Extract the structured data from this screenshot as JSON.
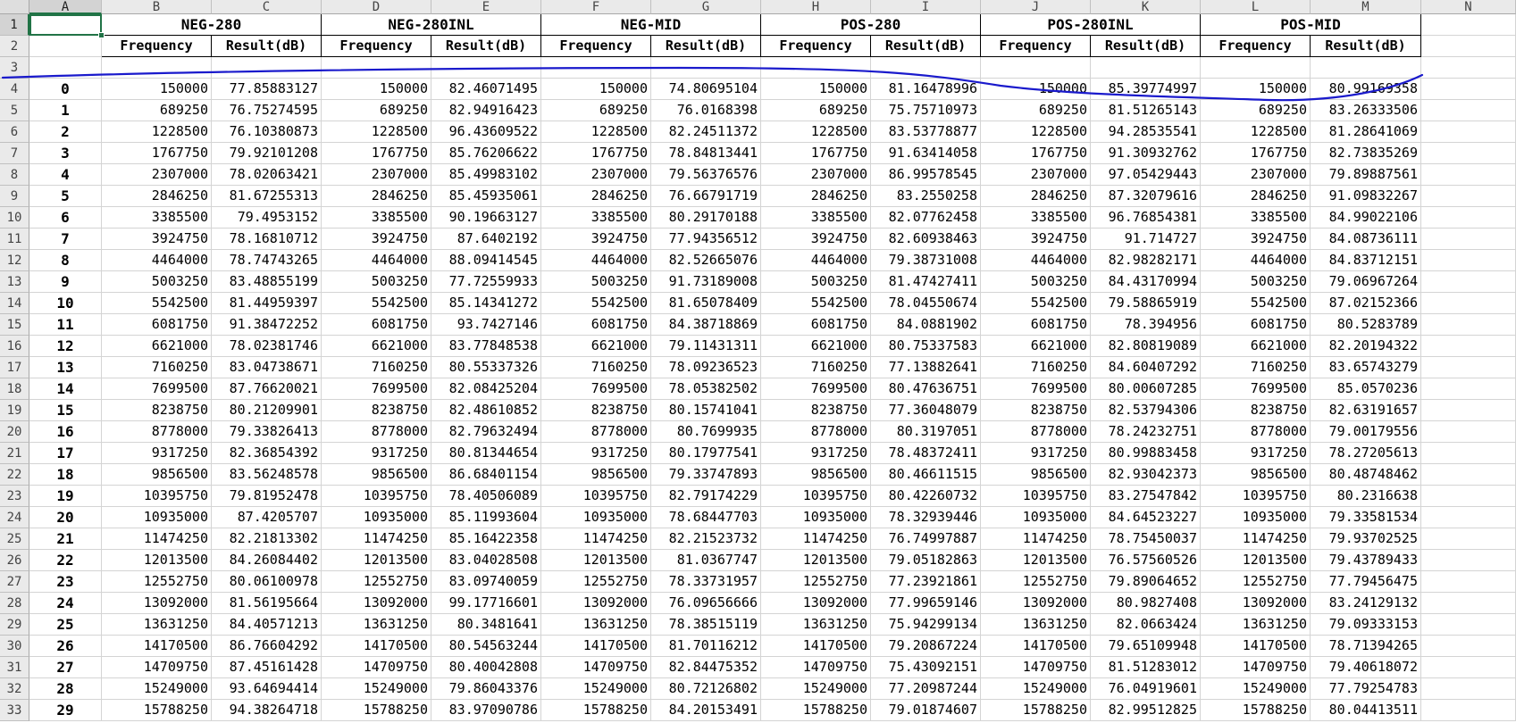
{
  "columns": [
    "A",
    "B",
    "C",
    "D",
    "E",
    "F",
    "G",
    "H",
    "I",
    "J",
    "K",
    "L",
    "M",
    "N"
  ],
  "groups": [
    "NEG-280",
    "NEG-280INL",
    "NEG-MID",
    "POS-280",
    "POS-280INL",
    "POS-MID"
  ],
  "sub_headers": [
    "Frequency",
    "Result(dB)"
  ],
  "row_numbers": [
    1,
    2,
    3,
    4,
    5,
    6,
    7,
    8,
    9,
    10,
    11,
    12,
    13,
    14,
    15,
    16,
    17,
    18,
    19,
    20,
    21,
    22,
    23,
    24,
    25,
    26,
    27,
    28,
    29,
    30,
    31,
    32,
    33
  ],
  "rows": [
    {
      "index": "0",
      "values": [
        "150000",
        "77.85883127",
        "150000",
        "82.46071495",
        "150000",
        "74.80695104",
        "150000",
        "81.16478996",
        "150000",
        "85.39774997",
        "150000",
        "80.99169358"
      ]
    },
    {
      "index": "1",
      "values": [
        "689250",
        "76.75274595",
        "689250",
        "82.94916423",
        "689250",
        "76.0168398",
        "689250",
        "75.75710973",
        "689250",
        "81.51265143",
        "689250",
        "83.26333506"
      ]
    },
    {
      "index": "2",
      "values": [
        "1228500",
        "76.10380873",
        "1228500",
        "96.43609522",
        "1228500",
        "82.24511372",
        "1228500",
        "83.53778877",
        "1228500",
        "94.28535541",
        "1228500",
        "81.28641069"
      ]
    },
    {
      "index": "3",
      "values": [
        "1767750",
        "79.92101208",
        "1767750",
        "85.76206622",
        "1767750",
        "78.84813441",
        "1767750",
        "91.63414058",
        "1767750",
        "91.30932762",
        "1767750",
        "82.73835269"
      ]
    },
    {
      "index": "4",
      "values": [
        "2307000",
        "78.02063421",
        "2307000",
        "85.49983102",
        "2307000",
        "79.56376576",
        "2307000",
        "86.99578545",
        "2307000",
        "97.05429443",
        "2307000",
        "79.89887561"
      ]
    },
    {
      "index": "5",
      "values": [
        "2846250",
        "81.67255313",
        "2846250",
        "85.45935061",
        "2846250",
        "76.66791719",
        "2846250",
        "83.2550258",
        "2846250",
        "87.32079616",
        "2846250",
        "91.09832267"
      ]
    },
    {
      "index": "6",
      "values": [
        "3385500",
        "79.4953152",
        "3385500",
        "90.19663127",
        "3385500",
        "80.29170188",
        "3385500",
        "82.07762458",
        "3385500",
        "96.76854381",
        "3385500",
        "84.99022106"
      ]
    },
    {
      "index": "7",
      "values": [
        "3924750",
        "78.16810712",
        "3924750",
        "87.6402192",
        "3924750",
        "77.94356512",
        "3924750",
        "82.60938463",
        "3924750",
        "91.714727",
        "3924750",
        "84.08736111"
      ]
    },
    {
      "index": "8",
      "values": [
        "4464000",
        "78.74743265",
        "4464000",
        "88.09414545",
        "4464000",
        "82.52665076",
        "4464000",
        "79.38731008",
        "4464000",
        "82.98282171",
        "4464000",
        "84.83712151"
      ]
    },
    {
      "index": "9",
      "values": [
        "5003250",
        "83.48855199",
        "5003250",
        "77.72559933",
        "5003250",
        "91.73189008",
        "5003250",
        "81.47427411",
        "5003250",
        "84.43170994",
        "5003250",
        "79.06967264"
      ]
    },
    {
      "index": "10",
      "values": [
        "5542500",
        "81.44959397",
        "5542500",
        "85.14341272",
        "5542500",
        "81.65078409",
        "5542500",
        "78.04550674",
        "5542500",
        "79.58865919",
        "5542500",
        "87.02152366"
      ]
    },
    {
      "index": "11",
      "values": [
        "6081750",
        "91.38472252",
        "6081750",
        "93.7427146",
        "6081750",
        "84.38718869",
        "6081750",
        "84.0881902",
        "6081750",
        "78.394956",
        "6081750",
        "80.5283789"
      ]
    },
    {
      "index": "12",
      "values": [
        "6621000",
        "78.02381746",
        "6621000",
        "83.77848538",
        "6621000",
        "79.11431311",
        "6621000",
        "80.75337583",
        "6621000",
        "82.80819089",
        "6621000",
        "82.20194322"
      ]
    },
    {
      "index": "13",
      "values": [
        "7160250",
        "83.04738671",
        "7160250",
        "80.55337326",
        "7160250",
        "78.09236523",
        "7160250",
        "77.13882641",
        "7160250",
        "84.60407292",
        "7160250",
        "83.65743279"
      ]
    },
    {
      "index": "14",
      "values": [
        "7699500",
        "87.76620021",
        "7699500",
        "82.08425204",
        "7699500",
        "78.05382502",
        "7699500",
        "80.47636751",
        "7699500",
        "80.00607285",
        "7699500",
        "85.0570236"
      ]
    },
    {
      "index": "15",
      "values": [
        "8238750",
        "80.21209901",
        "8238750",
        "82.48610852",
        "8238750",
        "80.15741041",
        "8238750",
        "77.36048079",
        "8238750",
        "82.53794306",
        "8238750",
        "82.63191657"
      ]
    },
    {
      "index": "16",
      "values": [
        "8778000",
        "79.33826413",
        "8778000",
        "82.79632494",
        "8778000",
        "80.7699935",
        "8778000",
        "80.3197051",
        "8778000",
        "78.24232751",
        "8778000",
        "79.00179556"
      ]
    },
    {
      "index": "17",
      "values": [
        "9317250",
        "82.36854392",
        "9317250",
        "80.81344654",
        "9317250",
        "80.17977541",
        "9317250",
        "78.48372411",
        "9317250",
        "80.99883458",
        "9317250",
        "78.27205613"
      ]
    },
    {
      "index": "18",
      "values": [
        "9856500",
        "83.56248578",
        "9856500",
        "86.68401154",
        "9856500",
        "79.33747893",
        "9856500",
        "80.46611515",
        "9856500",
        "82.93042373",
        "9856500",
        "80.48748462"
      ]
    },
    {
      "index": "19",
      "values": [
        "10395750",
        "79.81952478",
        "10395750",
        "78.40506089",
        "10395750",
        "82.79174229",
        "10395750",
        "80.42260732",
        "10395750",
        "83.27547842",
        "10395750",
        "80.2316638"
      ]
    },
    {
      "index": "20",
      "values": [
        "10935000",
        "87.4205707",
        "10935000",
        "85.11993604",
        "10935000",
        "78.68447703",
        "10935000",
        "78.32939446",
        "10935000",
        "84.64523227",
        "10935000",
        "79.33581534"
      ]
    },
    {
      "index": "21",
      "values": [
        "11474250",
        "82.21813302",
        "11474250",
        "85.16422358",
        "11474250",
        "82.21523732",
        "11474250",
        "76.74997887",
        "11474250",
        "78.75450037",
        "11474250",
        "79.93702525"
      ]
    },
    {
      "index": "22",
      "values": [
        "12013500",
        "84.26084402",
        "12013500",
        "83.04028508",
        "12013500",
        "81.0367747",
        "12013500",
        "79.05182863",
        "12013500",
        "76.57560526",
        "12013500",
        "79.43789433"
      ]
    },
    {
      "index": "23",
      "values": [
        "12552750",
        "80.06100978",
        "12552750",
        "83.09740059",
        "12552750",
        "78.33731957",
        "12552750",
        "77.23921861",
        "12552750",
        "79.89064652",
        "12552750",
        "77.79456475"
      ]
    },
    {
      "index": "24",
      "values": [
        "13092000",
        "81.56195664",
        "13092000",
        "99.17716601",
        "13092000",
        "76.09656666",
        "13092000",
        "77.99659146",
        "13092000",
        "80.9827408",
        "13092000",
        "83.24129132"
      ]
    },
    {
      "index": "25",
      "values": [
        "13631250",
        "84.40571213",
        "13631250",
        "80.3481641",
        "13631250",
        "78.38515119",
        "13631250",
        "75.94299134",
        "13631250",
        "82.0663424",
        "13631250",
        "79.09333153"
      ]
    },
    {
      "index": "26",
      "values": [
        "14170500",
        "86.76604292",
        "14170500",
        "80.54563244",
        "14170500",
        "81.70116212",
        "14170500",
        "79.20867224",
        "14170500",
        "79.65109948",
        "14170500",
        "78.71394265"
      ]
    },
    {
      "index": "27",
      "values": [
        "14709750",
        "87.45161428",
        "14709750",
        "80.40042808",
        "14709750",
        "82.84475352",
        "14709750",
        "75.43092151",
        "14709750",
        "81.51283012",
        "14709750",
        "79.40618072"
      ]
    },
    {
      "index": "28",
      "values": [
        "15249000",
        "93.64694414",
        "15249000",
        "79.86043376",
        "15249000",
        "80.72126802",
        "15249000",
        "77.20987244",
        "15249000",
        "76.04919601",
        "15249000",
        "77.79254783"
      ]
    },
    {
      "index": "29",
      "values": [
        "15788250",
        "94.38264718",
        "15788250",
        "83.97090786",
        "15788250",
        "84.20153491",
        "15788250",
        "79.01874607",
        "15788250",
        "82.99512825",
        "15788250",
        "80.04413511"
      ]
    }
  ],
  "colors": {
    "selection": "#217346",
    "annotation_ink": "#1a1acc",
    "header_bg": "#eaeaea",
    "grid": "#d4d4d4"
  }
}
